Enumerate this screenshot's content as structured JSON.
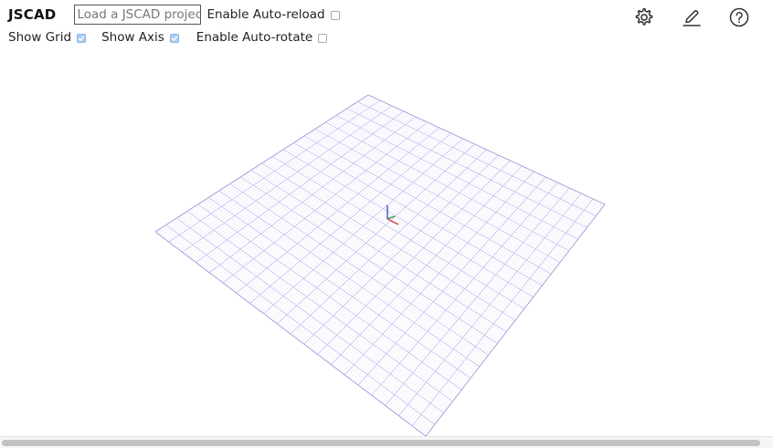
{
  "app": {
    "title": "JSCAD"
  },
  "toolbar": {
    "load_button_label": "Load a JSCAD project",
    "auto_reload": {
      "label": "Enable Auto-reload",
      "checked": false
    },
    "show_grid": {
      "label": "Show Grid",
      "checked": true
    },
    "show_axis": {
      "label": "Show Axis",
      "checked": true
    },
    "auto_rotate": {
      "label": "Enable Auto-rotate",
      "checked": false
    }
  },
  "icons": {
    "settings": "gear-icon",
    "editor": "pencil-icon",
    "help": "question-circle-icon"
  },
  "colors": {
    "grid_line": "#b9b9ee",
    "grid_border": "#9a9ad8",
    "axis_x": "#e03a3a",
    "axis_y": "#2e9a2e",
    "axis_z": "#3344cc",
    "checkbox_checked": "#a9d0f5"
  },
  "grid": {
    "divisions": 20
  }
}
